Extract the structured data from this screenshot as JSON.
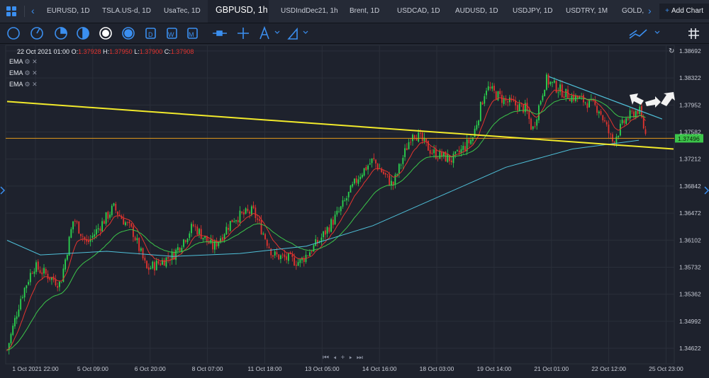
{
  "tabs": [
    {
      "label": "EURUSD, 1D"
    },
    {
      "label": "TSLA.US-d, 1D"
    },
    {
      "label": "UsaTec, 1D"
    },
    {
      "label": "GBPUSD, 1h"
    },
    {
      "label": "USDIndDec21, 1h"
    },
    {
      "label": "Brent, 1D"
    },
    {
      "label": "USDCAD, 1D"
    },
    {
      "label": "AUDUSD, 1D"
    },
    {
      "label": "USDJPY, 1D"
    },
    {
      "label": "USDTRY, 1M"
    },
    {
      "label": "GOLD,"
    }
  ],
  "active_tab": "GBPUSD, 1h",
  "add_chart": "Add Chart",
  "legend": {
    "date": "22 Oct 2021 01:00",
    "o_label": "O:",
    "o": "1.37928",
    "h_label": "H:",
    "h": "1.37950",
    "l_label": "L:",
    "l": "1.37900",
    "c_label": "C:",
    "c": "1.37908",
    "indicators": [
      "EMA",
      "EMA",
      "EMA"
    ]
  },
  "colors": {
    "up": "#2bd44f",
    "down": "#e3342f",
    "ema_fast": "#e3342f",
    "ema_mid": "#3cc54a",
    "ema_slow": "#4fc0d9",
    "trend": "#f2ea2b",
    "hline": "#e39a1c",
    "price_tag": "#3cc54a"
  },
  "chart_data": {
    "type": "candlestick",
    "symbol": "GBPUSD",
    "timeframe": "1h",
    "y_ticks": [
      "1.38692",
      "1.38322",
      "1.37952",
      "1.37582",
      "1.37212",
      "1.36842",
      "1.36472",
      "1.36102",
      "1.35732",
      "1.35362",
      "1.34992",
      "1.34622"
    ],
    "x_ticks": [
      "1 Oct 2021 22:00",
      "5 Oct 09:00",
      "6 Oct 20:00",
      "8 Oct 07:00",
      "11 Oct 18:00",
      "13 Oct 05:00",
      "14 Oct 16:00",
      "18 Oct 03:00",
      "19 Oct 14:00",
      "21 Oct 01:00",
      "22 Oct 12:00",
      "25 Oct 23:00"
    ],
    "ylim": [
      1.3445,
      1.388
    ],
    "last_price": "1.37496",
    "horizontal_line": 1.37496,
    "key_points": [
      {
        "t": 0.0,
        "p": 1.346
      },
      {
        "t": 0.02,
        "p": 1.353
      },
      {
        "t": 0.04,
        "p": 1.3575
      },
      {
        "t": 0.08,
        "p": 1.355
      },
      {
        "t": 0.1,
        "p": 1.364
      },
      {
        "t": 0.12,
        "p": 1.3605
      },
      {
        "t": 0.16,
        "p": 1.3655
      },
      {
        "t": 0.19,
        "p": 1.362
      },
      {
        "t": 0.21,
        "p": 1.357
      },
      {
        "t": 0.25,
        "p": 1.359
      },
      {
        "t": 0.28,
        "p": 1.363
      },
      {
        "t": 0.31,
        "p": 1.36
      },
      {
        "t": 0.34,
        "p": 1.364
      },
      {
        "t": 0.37,
        "p": 1.365
      },
      {
        "t": 0.4,
        "p": 1.359
      },
      {
        "t": 0.44,
        "p": 1.358
      },
      {
        "t": 0.47,
        "p": 1.361
      },
      {
        "t": 0.5,
        "p": 1.365
      },
      {
        "t": 0.53,
        "p": 1.37
      },
      {
        "t": 0.55,
        "p": 1.372
      },
      {
        "t": 0.58,
        "p": 1.3685
      },
      {
        "t": 0.61,
        "p": 1.376
      },
      {
        "t": 0.64,
        "p": 1.373
      },
      {
        "t": 0.67,
        "p": 1.372
      },
      {
        "t": 0.7,
        "p": 1.375
      },
      {
        "t": 0.72,
        "p": 1.382
      },
      {
        "t": 0.75,
        "p": 1.38
      },
      {
        "t": 0.78,
        "p": 1.379
      },
      {
        "t": 0.79,
        "p": 1.376
      },
      {
        "t": 0.81,
        "p": 1.383
      },
      {
        "t": 0.84,
        "p": 1.381
      },
      {
        "t": 0.87,
        "p": 1.38
      },
      {
        "t": 0.89,
        "p": 1.379
      },
      {
        "t": 0.91,
        "p": 1.3745
      },
      {
        "t": 0.93,
        "p": 1.3775
      },
      {
        "t": 0.95,
        "p": 1.379
      },
      {
        "t": 0.96,
        "p": 1.3755
      }
    ],
    "ema_slow_points": [
      {
        "t": 0.0,
        "p": 1.361
      },
      {
        "t": 0.05,
        "p": 1.359
      },
      {
        "t": 0.15,
        "p": 1.3595
      },
      {
        "t": 0.25,
        "p": 1.3588
      },
      {
        "t": 0.35,
        "p": 1.3592
      },
      {
        "t": 0.45,
        "p": 1.3602
      },
      {
        "t": 0.55,
        "p": 1.363
      },
      {
        "t": 0.65,
        "p": 1.367
      },
      {
        "t": 0.75,
        "p": 1.371
      },
      {
        "t": 0.85,
        "p": 1.3735
      },
      {
        "t": 0.95,
        "p": 1.3747
      }
    ],
    "trendlines": [
      {
        "from": {
          "t": 0.0,
          "p": 1.38
        },
        "to": {
          "t": 1.0,
          "p": 1.3735
        }
      },
      {
        "from": {
          "t": 0.815,
          "p": 1.3834
        },
        "to": {
          "t": 0.985,
          "p": 1.3776
        }
      }
    ]
  }
}
